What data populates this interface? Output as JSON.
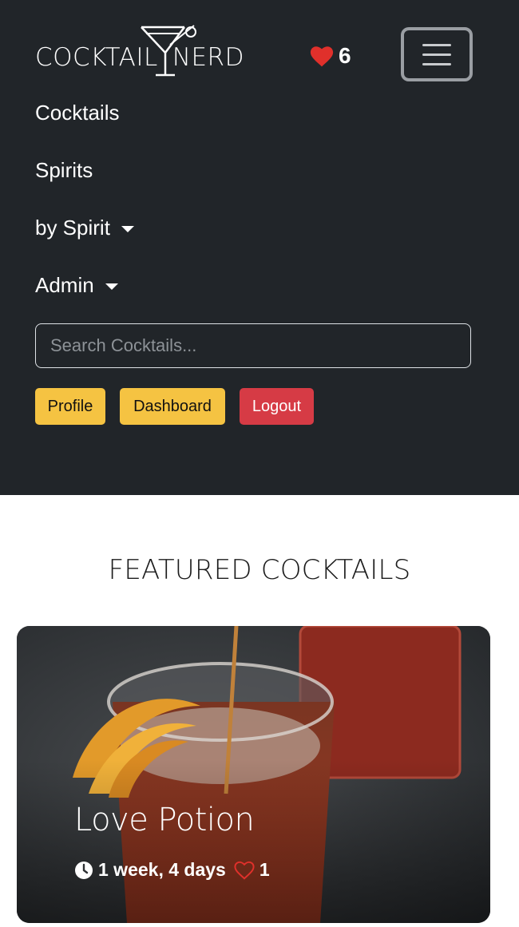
{
  "brand": {
    "left": "COCKTAIL",
    "right": "NERD"
  },
  "favorites": {
    "count": "6",
    "icon": "heart-icon",
    "color": "#e0302b"
  },
  "menu": {
    "icon": "hamburger-menu-icon"
  },
  "nav": {
    "items": [
      {
        "label": "Cocktails"
      },
      {
        "label": "Spirits"
      },
      {
        "label": "by Spirit"
      },
      {
        "label": "Admin"
      }
    ]
  },
  "search": {
    "placeholder": "Search Cocktails..."
  },
  "buttons": {
    "profile": "Profile",
    "dashboard": "Dashboard",
    "logout": "Logout"
  },
  "featured": {
    "title": "FEATURED COCKTAILS",
    "cards": [
      {
        "name": "Love Potion",
        "time": "1 week, 4 days",
        "likes": "1",
        "clock_icon": "clock-icon",
        "heart_icon": "heart-outline-icon"
      }
    ]
  },
  "colors": {
    "navbar": "#212529",
    "warning": "#f5c342",
    "danger": "#d63b45"
  }
}
